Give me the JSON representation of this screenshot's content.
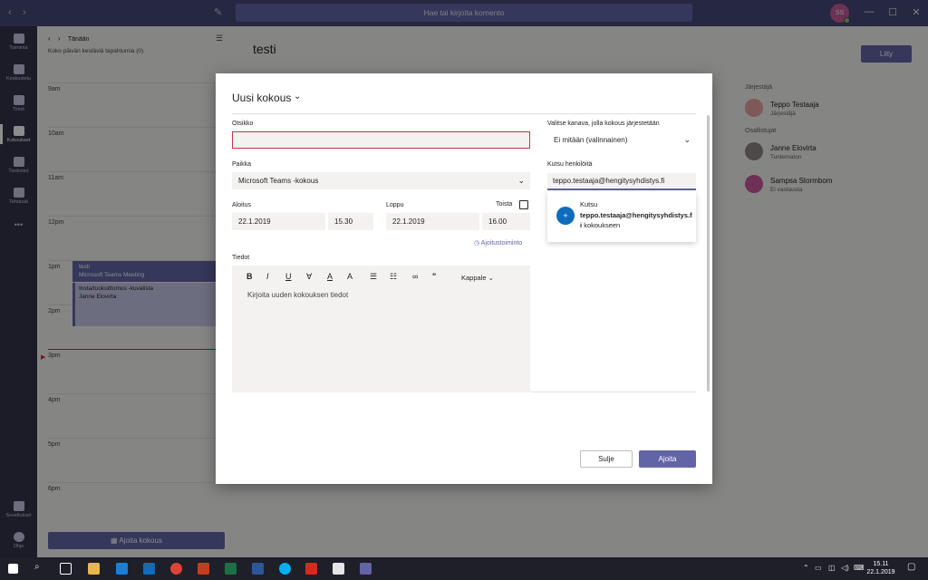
{
  "titlebar": {
    "search_placeholder": "Hae tai kirjoita komento",
    "avatar_initials": "SS",
    "nav_back": "‹",
    "nav_forward": "›",
    "compose": "✎",
    "min": "—",
    "max": "☐",
    "close": "✕"
  },
  "rail": {
    "items": [
      {
        "label": "Toiminta"
      },
      {
        "label": "Keskustelu"
      },
      {
        "label": "Tiimit"
      },
      {
        "label": "Kokoukset"
      },
      {
        "label": "Tiedostot"
      },
      {
        "label": "Tehtävät"
      },
      {
        "label": "•••"
      },
      {
        "label": "Sovellukset"
      },
      {
        "label": "Ohje"
      }
    ]
  },
  "calendar": {
    "today": "Tänään",
    "allday": "Koko päivän kestäviä tapahtumia (0)",
    "hours": [
      "9am",
      "10am",
      "11am",
      "12pm",
      "1pm",
      "2pm",
      "3pm",
      "4pm",
      "5pm",
      "6pm"
    ],
    "events": [
      {
        "title": "testi",
        "subtitle": "Microsoft Teams Meeting"
      },
      {
        "title": "Insta/tuokuittomus -kuvalista",
        "subtitle": "Janne Elovirta"
      }
    ],
    "schedule_button": "Ajoita kokous"
  },
  "main": {
    "title": "testi",
    "join_button": "Liity",
    "organizer_label": "Järjestäjä",
    "participants_label": "Osallistujat",
    "organizer": {
      "name": "Teppo Testaaja",
      "status": "Järjestäjä"
    },
    "participants": [
      {
        "name": "Janne Elovirta",
        "status": "Tuntematon"
      },
      {
        "name": "Sampsa Stormbom",
        "status": "Ei vastausta"
      }
    ]
  },
  "dialog": {
    "title": "Uusi kokous",
    "title_label": "Otsikko",
    "title_value": "",
    "channel_label": "Valitse kanava, jolla kokous järjestetään",
    "channel_value": "Ei mitään (valinnainen)",
    "location_label": "Paikka",
    "location_value": "Microsoft Teams -kokous",
    "invite_label": "Kutsu henkilöitä",
    "invite_value": "teppo.testaaja@hengitysyhdistys.fi",
    "start_label": "Aloitus",
    "start_date": "22.1.2019",
    "start_time": "15.30",
    "end_label": "Loppu",
    "end_date": "22.1.2019",
    "end_time": "16.00",
    "repeat_label": "Toista",
    "assistant_link": "Ajoitustoiminto",
    "details_label": "Tiedot",
    "details_placeholder": "Kirjoita uuden kokouksen tiedot",
    "paragraph_style": "Kappale",
    "suggestion": {
      "prefix": "Kutsu",
      "email": "teppo.testaaja@hengitysyhdistys.fi",
      "suffix": "kokoukseen"
    },
    "close_button": "Sulje",
    "save_button": "Ajoita"
  },
  "taskbar": {
    "time": "15.11",
    "date": "22.1.2019"
  },
  "colors": {
    "brand": "#6264a7",
    "titlebar": "#464775",
    "rail": "#33344a",
    "error": "#c4314b"
  }
}
